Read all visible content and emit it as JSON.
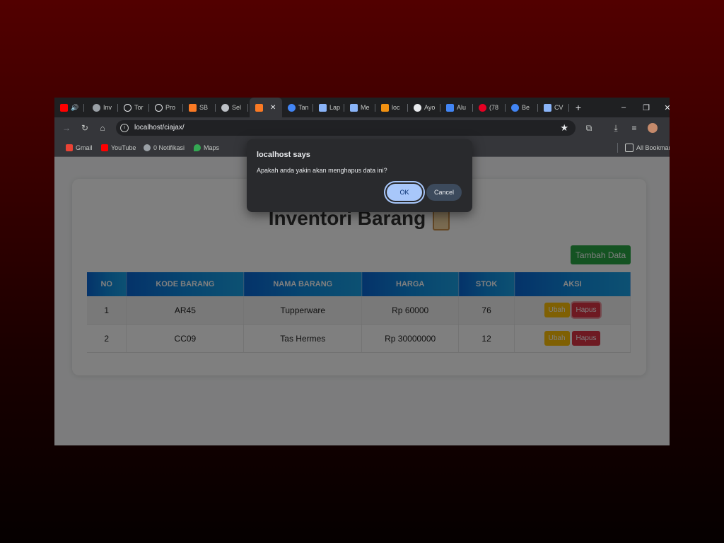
{
  "browser": {
    "tabs": [
      {
        "label": "",
        "icon": "youtube-icon",
        "color": "#ff0000",
        "audio": "🔊"
      },
      {
        "label": "Inv",
        "icon": "globe-icon",
        "color": "#9aa0a6"
      },
      {
        "label": "Tor",
        "icon": "openai-icon",
        "color": "#e8eaed"
      },
      {
        "label": "Pro",
        "icon": "openai-icon",
        "color": "#e8eaed"
      },
      {
        "label": "SB",
        "icon": "xampp-icon",
        "color": "#fb7a24"
      },
      {
        "label": "Sel",
        "icon": "robot-icon",
        "color": "#e8eaed"
      },
      {
        "label": "",
        "icon": "xampp-icon",
        "color": "#fb7a24",
        "active": true,
        "close": "✕"
      },
      {
        "label": "Tan",
        "icon": "c-icon",
        "color": "#4285f4"
      },
      {
        "label": "Lap",
        "icon": "grid-icon",
        "color": "#8ab4f8"
      },
      {
        "label": "Me",
        "icon": "grid-icon",
        "color": "#8ab4f8"
      },
      {
        "label": "loc",
        "icon": "phpmyadmin-icon",
        "color": "#f29111"
      },
      {
        "label": "Ayo",
        "icon": "github-icon",
        "color": "#e8eaed"
      },
      {
        "label": "Alu",
        "icon": "docs-icon",
        "color": "#4285f4"
      },
      {
        "label": "(78",
        "icon": "pinterest-icon",
        "color": "#e60023"
      },
      {
        "label": "Be",
        "icon": "c-icon",
        "color": "#4285f4"
      },
      {
        "label": "CV",
        "icon": "form-icon",
        "color": "#8ab4f8"
      }
    ],
    "new_tab": "+",
    "window_controls": {
      "minimize": "–",
      "restore": "❐",
      "close": "✕"
    },
    "url": "localhost/ciajax/",
    "bookmarks": [
      {
        "label": "Gmail",
        "icon": "gmail-icon",
        "color": "#ea4335"
      },
      {
        "label": "YouTube",
        "icon": "youtube-icon",
        "color": "#ff0000"
      },
      {
        "label": "0 Notifikasi",
        "icon": "globe-icon",
        "color": "#9aa0a6"
      },
      {
        "label": "Maps",
        "icon": "maps-icon",
        "color": "#34a853"
      }
    ],
    "all_bookmarks": "All Bookmarks"
  },
  "page": {
    "title": "Inventori Barang",
    "add_button": "Tambah Data",
    "columns": [
      "NO",
      "KODE BARANG",
      "NAMA BARANG",
      "HARGA",
      "STOK",
      "AKSI"
    ],
    "rows": [
      {
        "no": "1",
        "kode": "AR45",
        "nama": "Tupperware",
        "harga": "Rp 60000",
        "stok": "76"
      },
      {
        "no": "2",
        "kode": "CC09",
        "nama": "Tas Hermes",
        "harga": "Rp 30000000",
        "stok": "12"
      }
    ],
    "edit_label": "Ubah",
    "delete_label": "Hapus"
  },
  "dialog": {
    "title": "localhost says",
    "message": "Apakah anda yakin akan menghapus data ini?",
    "ok": "OK",
    "cancel": "Cancel"
  }
}
